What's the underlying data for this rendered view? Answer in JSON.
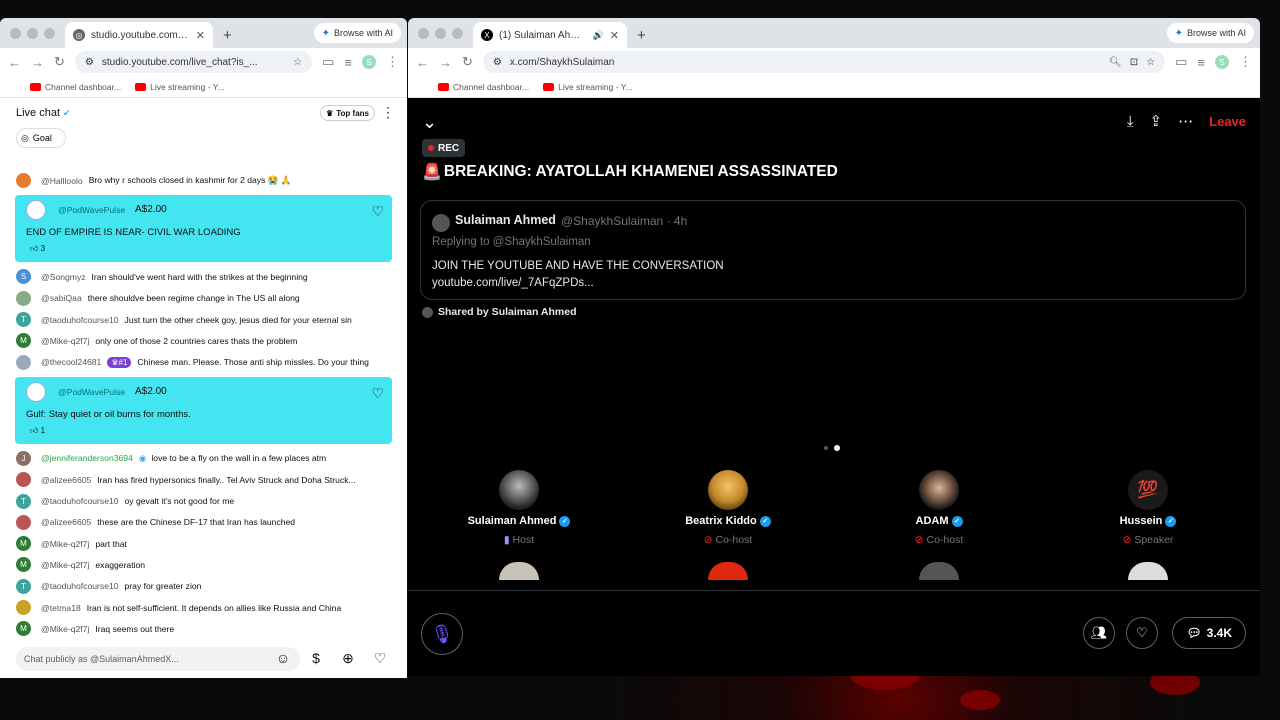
{
  "left_window": {
    "tab_title": "studio.youtube.com/live_chat",
    "browse_ai": "Browse with AI",
    "url": "studio.youtube.com/live_chat?is_...",
    "bookmarks": [
      "Channel dashboar...",
      "Live streaming - Y..."
    ],
    "profile_initial": "S"
  },
  "chat": {
    "title": "Live chat",
    "top_fans": "Top fans",
    "goal": "Goal",
    "input_placeholder": "Chat publicly as @SulaimanAhmedX...",
    "messages": [
      {
        "author": "@Hallloolo",
        "text": "Bro why r schools closed in kashmir for 2 days 😭 🙏",
        "color": "#e87b2b",
        "initial": ""
      },
      {
        "superchat": true,
        "author": "@PodWavePulse",
        "amount": "A$2.00",
        "text": "END OF EMPIRE IS NEAR- CIVIL WAR LOADING",
        "likes": "3"
      },
      {
        "author": "@Songmyz",
        "text": "Iran should've went hard with the strikes at the beginning",
        "color": "#4a90d9",
        "initial": "S"
      },
      {
        "author": "@sabiQaa",
        "text": "there shouldve been regime change in The US all along",
        "color": "#8a8",
        "initial": ""
      },
      {
        "author": "@taoduhofcourse10",
        "text": "Just turn the other cheek goy, jesus died for your eternal sin",
        "color": "#3aa59b",
        "initial": "T"
      },
      {
        "author": "@Mike-q2f7j",
        "text": "only one of those 2 countries cares thats the problem",
        "color": "#2e7d32",
        "initial": "M"
      },
      {
        "author": "@thecool24681",
        "badge": "#1",
        "text": "Chinese man. Please. Those anti ship missles. Do your thing",
        "color": "#9ab",
        "initial": ""
      },
      {
        "superchat": true,
        "author": "@PodWavePulse",
        "amount": "A$2.00",
        "text": "Gulf: Stay quiet or oil burns for months.",
        "likes": "1"
      },
      {
        "author": "@jenniferanderson3694",
        "green": true,
        "text": "love to be a fly on the wall in a few places atm",
        "color": "#8d6e63",
        "initial": "J"
      },
      {
        "author": "@alizee6605",
        "text": "Iran has fired hypersonics finally.. Tel Aviv Struck and Doha Struck...",
        "color": "#b55",
        "initial": ""
      },
      {
        "author": "@taoduhofcourse10",
        "text": "oy gevalt it's not good for me",
        "color": "#3aa59b",
        "initial": "T"
      },
      {
        "author": "@alizee6605",
        "text": "these are the Chinese DF-17 that Iran has launched",
        "color": "#b55",
        "initial": ""
      },
      {
        "author": "@Mike-q2f7j",
        "text": "part that",
        "color": "#2e7d32",
        "initial": "M"
      },
      {
        "author": "@Mike-q2f7j",
        "text": "exaggeration",
        "color": "#2e7d32",
        "initial": "M"
      },
      {
        "author": "@taoduhofcourse10",
        "text": "pray for greater zion",
        "color": "#3aa59b",
        "initial": "T"
      },
      {
        "author": "@tetma18",
        "text": "Iran is not self-sufficient. It depends on allies like Russia and China",
        "color": "#c9a227",
        "initial": ""
      },
      {
        "author": "@Mike-q2f7j",
        "text": "Iraq seems out there",
        "color": "#2e7d32",
        "initial": "M"
      }
    ]
  },
  "right_window": {
    "tab_title": "(1) Sulaiman Ahmed (@S",
    "browse_ai": "Browse with AI",
    "url": "x.com/ShaykhSulaiman",
    "bookmarks": [
      "Channel dashboar...",
      "Live streaming - Y..."
    ],
    "profile_initial": "S"
  },
  "space": {
    "leave": "Leave",
    "rec": "REC",
    "title": "BREAKING: AYATOLLAH KHAMENEI ASSASSINATED",
    "tweet": {
      "name": "Sulaiman Ahmed",
      "handle": "@ShaykhSulaiman · 4h",
      "replying": "Replying to @ShaykhSulaiman",
      "body": "JOIN THE YOUTUBE AND HAVE THE CONVERSATION",
      "link": "youtube.com/live/_7AFqZPDs..."
    },
    "shared_by": "Shared by Sulaiman Ahmed",
    "participants": [
      {
        "name": "Sulaiman Ahmed",
        "role": "Host"
      },
      {
        "name": "Beatrix Kiddo",
        "role": "Co-host"
      },
      {
        "name": "ADAM",
        "role": "Co-host"
      },
      {
        "name": "Hussein",
        "role": "Speaker"
      }
    ],
    "comments_count": "3.4K"
  }
}
